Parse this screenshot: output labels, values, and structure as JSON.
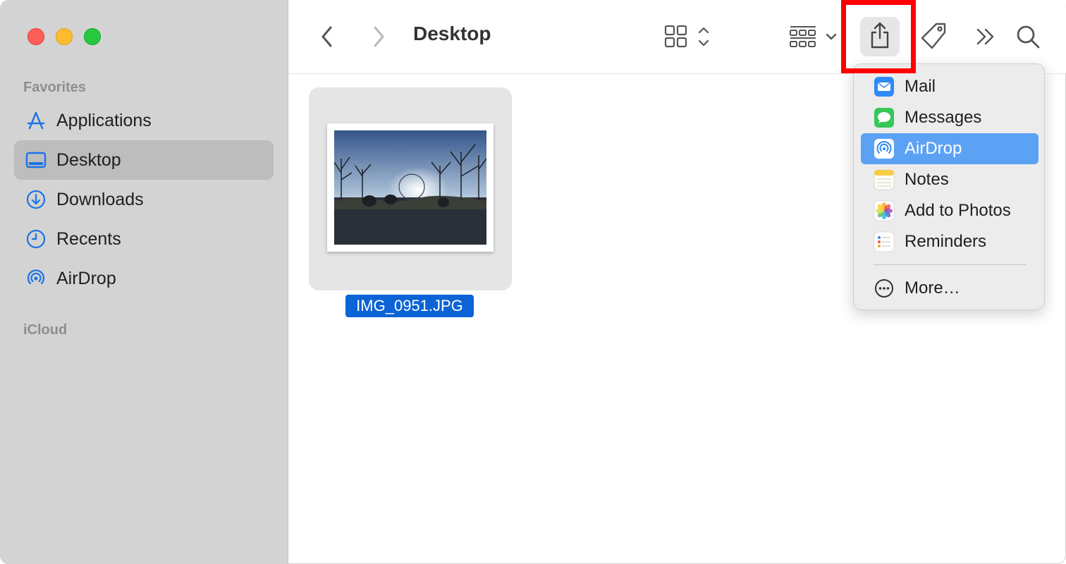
{
  "window": {
    "title": "Desktop"
  },
  "sidebar": {
    "favorites_label": "Favorites",
    "icloud_label": "iCloud",
    "items": [
      {
        "label": "Applications",
        "icon": "applications-icon"
      },
      {
        "label": "Desktop",
        "icon": "desktop-icon",
        "selected": true
      },
      {
        "label": "Downloads",
        "icon": "downloads-icon"
      },
      {
        "label": "Recents",
        "icon": "recents-icon"
      },
      {
        "label": "AirDrop",
        "icon": "airdrop-icon"
      }
    ]
  },
  "toolbar": {
    "back": "back-icon",
    "forward": "forward-icon",
    "view_mode": "grid-view-icon",
    "group": "group-icon",
    "share": "share-icon",
    "tag": "tag-icon",
    "more": "chevrons-right-icon",
    "search": "search-icon"
  },
  "content": {
    "files": [
      {
        "name": "IMG_0951.JPG",
        "selected": true
      }
    ]
  },
  "share_menu": {
    "items": [
      {
        "label": "Mail",
        "icon": "mail-icon"
      },
      {
        "label": "Messages",
        "icon": "messages-icon"
      },
      {
        "label": "AirDrop",
        "icon": "airdrop-icon",
        "highlighted": true
      },
      {
        "label": "Notes",
        "icon": "notes-icon"
      },
      {
        "label": "Add to Photos",
        "icon": "photos-icon"
      },
      {
        "label": "Reminders",
        "icon": "reminders-icon"
      }
    ],
    "more_label": "More…"
  },
  "colors": {
    "accent": "#0b63d6",
    "menu_highlight": "#5ba2f5",
    "annotation_box": "#ff0000",
    "sidebar_icon": "#1a73e8"
  }
}
